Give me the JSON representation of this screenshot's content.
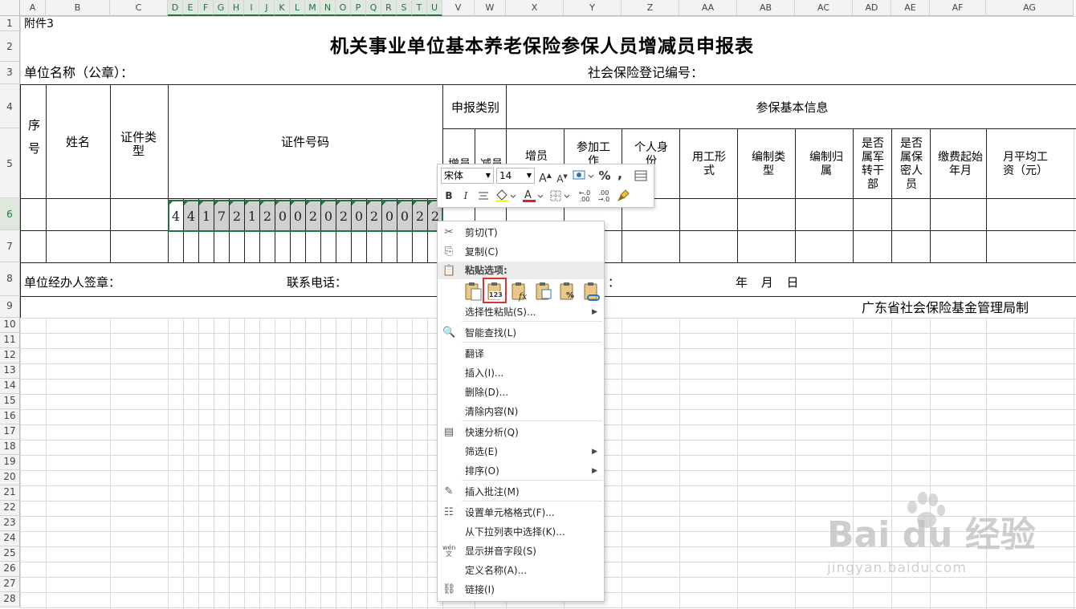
{
  "columns": [
    "A",
    "B",
    "C",
    "D",
    "E",
    "F",
    "G",
    "H",
    "I",
    "J",
    "K",
    "L",
    "M",
    "N",
    "O",
    "P",
    "Q",
    "R",
    "S",
    "T",
    "U",
    "V",
    "W",
    "X",
    "Y",
    "Z",
    "AA",
    "AB",
    "AC",
    "AD",
    "AE",
    "AF",
    "AG"
  ],
  "rows": [
    "1",
    "2",
    "3",
    "4",
    "5",
    "6",
    "7",
    "8",
    "9",
    "10",
    "11",
    "12",
    "13",
    "14",
    "15",
    "16",
    "17",
    "18",
    "19",
    "20",
    "21",
    "22",
    "23",
    "24",
    "25",
    "26",
    "27",
    "28"
  ],
  "sheet": {
    "attachment": "附件3",
    "title": "机关事业单位基本养老保险参保人员增减员申报表",
    "unit_name": "单位名称（公章）：",
    "reg_no": "社会保险登记编号：",
    "signer": "单位经办人签章：",
    "phone": "联系电话：",
    "date_label": "年 月 日",
    "footer": "广东省社会保险基金管理局制",
    "headers": {
      "seq": "序号",
      "name": "姓名",
      "id_type": "证件类型",
      "id_no": "证件号码",
      "apply_type": "申报类别",
      "basic_info": "参保基本信息",
      "add": "增员",
      "remove": "减员",
      "inc": "增员",
      "join_work": "参加工作",
      "personal_id": "个人身份",
      "employ_form": "用工形式",
      "staff_type": "编制类型",
      "staff_belong": "编制归属",
      "military": "是否属军转干部",
      "secret": "是否属保密人员",
      "pay_start": "缴费起始年月",
      "avg_wage": "月平均工资（元）"
    },
    "id_digits": [
      "4",
      "4",
      "1",
      "7",
      "2",
      "1",
      "2",
      "0",
      "0",
      "2",
      "0",
      "2",
      "0",
      "2",
      "0",
      "0",
      "2",
      "2"
    ],
    "partial_date_label": "：",
    "selected_columns": [
      "D",
      "E",
      "F",
      "G",
      "H",
      "I",
      "J",
      "K",
      "L",
      "M",
      "N",
      "O",
      "P",
      "Q",
      "R",
      "S",
      "T",
      "U"
    ],
    "selected_row": "6"
  },
  "mini_toolbar": {
    "font": "宋体",
    "size": "14",
    "grow_font": "A",
    "shrink_font": "A",
    "percent": "%",
    "comma": ",",
    "bold": "B",
    "italic": "I",
    "dec_inc": "←.0 .00",
    "dec_dec": ".00 →.0"
  },
  "context_menu": {
    "items": [
      {
        "label": "剪切(T)",
        "icon": "cut-icon"
      },
      {
        "label": "复制(C)",
        "icon": "copy-icon"
      },
      {
        "label": "粘贴选项:",
        "icon": "paste-icon"
      },
      {
        "label": "选择性粘贴(S)...",
        "icon": "",
        "submenu": true
      },
      {
        "label": "智能查找(L)",
        "icon": "smart-lookup-icon"
      },
      {
        "label": "翻译",
        "icon": ""
      },
      {
        "label": "插入(I)...",
        "icon": ""
      },
      {
        "label": "删除(D)...",
        "icon": ""
      },
      {
        "label": "清除内容(N)",
        "icon": ""
      },
      {
        "label": "快速分析(Q)",
        "icon": "quick-analysis-icon"
      },
      {
        "label": "筛选(E)",
        "icon": "",
        "submenu": true
      },
      {
        "label": "排序(O)",
        "icon": "",
        "submenu": true
      },
      {
        "label": "插入批注(M)",
        "icon": "insert-comment-icon"
      },
      {
        "label": "设置单元格格式(F)...",
        "icon": "format-cells-icon"
      },
      {
        "label": "从下拉列表中选择(K)...",
        "icon": ""
      },
      {
        "label": "显示拼音字段(S)",
        "icon": "phonetic-icon"
      },
      {
        "label": "定义名称(A)...",
        "icon": ""
      },
      {
        "label": "链接(I)",
        "icon": "link-icon"
      }
    ],
    "paste_values_label": "123",
    "phonetic_glyph": "wén 文"
  },
  "watermark": {
    "brand": "Bai du 经验",
    "url": "jingyan.baidu.com"
  },
  "colors": {
    "selection_green": "#217346",
    "highlight_red": "#e03030",
    "digit_shade": "#d0d0d0"
  }
}
